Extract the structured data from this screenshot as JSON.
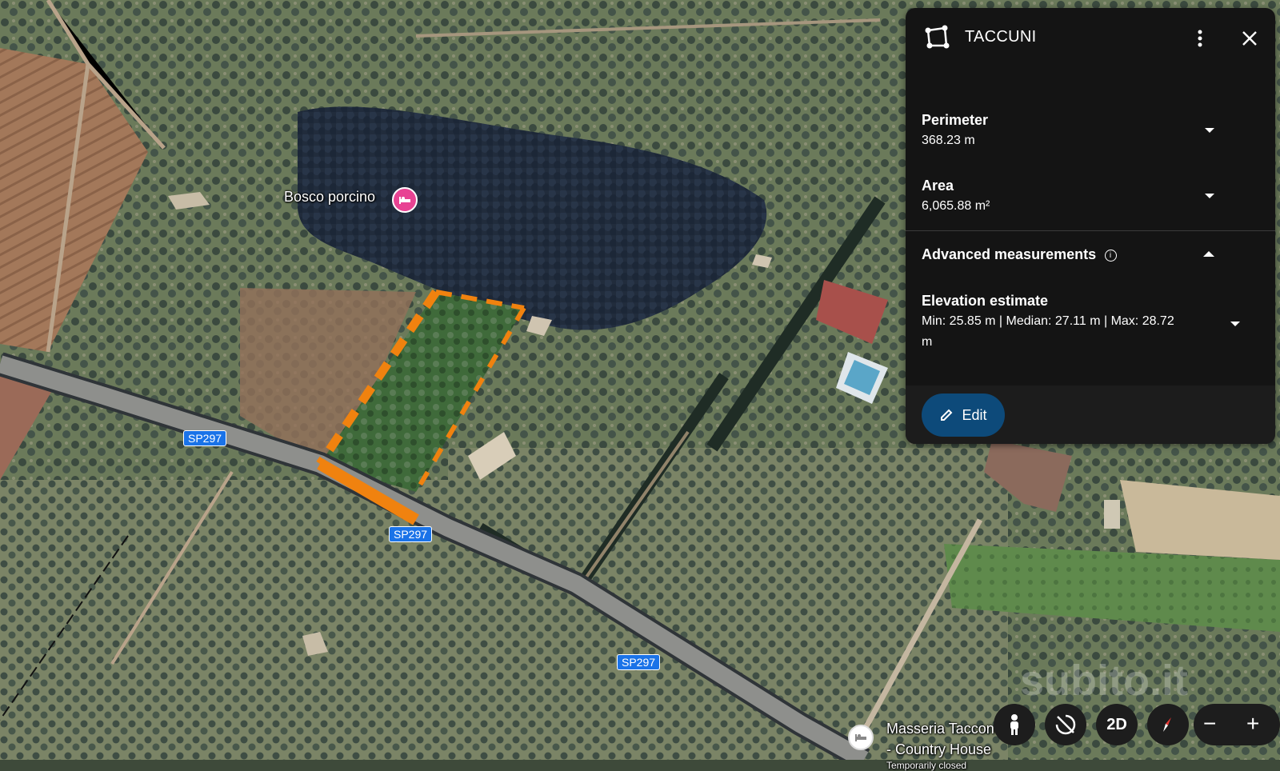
{
  "map": {
    "places": [
      {
        "name": "Bosco porcino"
      },
      {
        "name": "Masseria Taccone - Country House",
        "line1": "Masseria Taccone",
        "line2": "- Country House",
        "note": "Temporarily closed"
      }
    ],
    "road_shields": [
      "SP297",
      "SP297",
      "SP297"
    ],
    "watermark": "subito.it",
    "colors": {
      "polygon": "#f0820f",
      "panel_bg": "#141414",
      "edit_bg": "#0d4a7a",
      "shield": "#1a73e8"
    }
  },
  "panel": {
    "title": "TACCUNI",
    "icon": "polygon-measure-icon",
    "perimeter": {
      "label": "Perimeter",
      "value": "368.23 m"
    },
    "area": {
      "label": "Area",
      "value": "6,065.88 m²"
    },
    "advanced": {
      "label": "Advanced measurements"
    },
    "elevation": {
      "label": "Elevation estimate",
      "value": "Min: 25.85 m | Median: 27.11 m | Max: 28.72 m"
    },
    "edit_label": "Edit"
  },
  "controls": {
    "two_d_label": "2D",
    "zoom_out_label": "−",
    "zoom_in_label": "+"
  }
}
